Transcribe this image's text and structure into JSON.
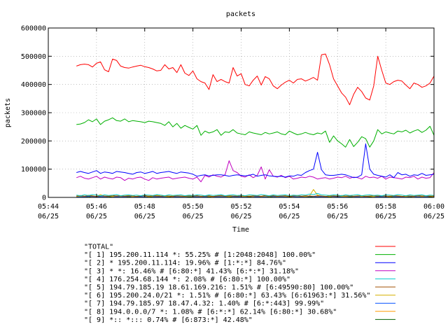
{
  "chart_data": {
    "type": "line",
    "title": "packets",
    "xlabel": "Time",
    "ylabel": "packets",
    "ylim": [
      0,
      600000
    ],
    "yticks": [
      0,
      100000,
      200000,
      300000,
      400000,
      500000,
      600000
    ],
    "ytick_labels": [
      "0",
      "100000",
      "200000",
      "300000",
      "400000",
      "500000",
      "600000"
    ],
    "xlim": [
      "05:44",
      "06:00"
    ],
    "xticks": [
      {
        "time": "05:44",
        "date": "06/25"
      },
      {
        "time": "05:46",
        "date": "06/25"
      },
      {
        "time": "05:48",
        "date": "06/25"
      },
      {
        "time": "05:50",
        "date": "06/25"
      },
      {
        "time": "05:52",
        "date": "06/25"
      },
      {
        "time": "05:54",
        "date": "06/25"
      },
      {
        "time": "05:56",
        "date": "06/25"
      },
      {
        "time": "05:58",
        "date": "06/25"
      },
      {
        "time": "06:00",
        "date": "06/25"
      }
    ],
    "grid": true,
    "legend_position": "bottom",
    "x": [
      "05:45:10",
      "05:45:20",
      "05:45:30",
      "05:45:40",
      "05:45:50",
      "05:46:00",
      "05:46:10",
      "05:46:20",
      "05:46:30",
      "05:46:40",
      "05:46:50",
      "05:47:00",
      "05:47:10",
      "05:47:20",
      "05:47:30",
      "05:47:40",
      "05:47:50",
      "05:48:00",
      "05:48:10",
      "05:48:20",
      "05:48:30",
      "05:48:40",
      "05:48:50",
      "05:49:00",
      "05:49:10",
      "05:49:20",
      "05:49:30",
      "05:49:40",
      "05:49:50",
      "05:50:00",
      "05:50:10",
      "05:50:20",
      "05:50:30",
      "05:50:40",
      "05:50:50",
      "05:51:00",
      "05:51:10",
      "05:51:20",
      "05:51:30",
      "05:51:40",
      "05:51:50",
      "05:52:00",
      "05:52:10",
      "05:52:20",
      "05:52:30",
      "05:52:40",
      "05:52:50",
      "05:53:00",
      "05:53:10",
      "05:53:20",
      "05:53:30",
      "05:53:40",
      "05:53:50",
      "05:54:00",
      "05:54:10",
      "05:54:20",
      "05:54:30",
      "05:54:40",
      "05:54:50",
      "05:55:00",
      "05:55:10",
      "05:55:20",
      "05:55:30",
      "05:55:40",
      "05:55:50",
      "05:56:00",
      "05:56:10",
      "05:56:20",
      "05:56:30",
      "05:56:40",
      "05:56:50",
      "05:57:00",
      "05:57:10",
      "05:57:20",
      "05:57:30",
      "05:57:40",
      "05:57:50",
      "05:58:00",
      "05:58:10",
      "05:58:20",
      "05:58:30",
      "05:58:40",
      "05:58:50",
      "05:59:00",
      "05:59:10",
      "05:59:20",
      "05:59:30",
      "05:59:40",
      "05:59:50",
      "06:00:00"
    ],
    "series": [
      {
        "name": "\"TOTAL\"",
        "color": "#ff0000",
        "values": [
          465000,
          470000,
          472000,
          470000,
          462000,
          475000,
          480000,
          452000,
          445000,
          490000,
          485000,
          465000,
          460000,
          458000,
          462000,
          465000,
          468000,
          463000,
          460000,
          455000,
          448000,
          450000,
          470000,
          455000,
          460000,
          442000,
          470000,
          440000,
          432000,
          448000,
          420000,
          410000,
          405000,
          382000,
          435000,
          410000,
          418000,
          410000,
          405000,
          460000,
          430000,
          438000,
          400000,
          395000,
          415000,
          430000,
          398000,
          428000,
          420000,
          395000,
          385000,
          398000,
          408000,
          415000,
          405000,
          418000,
          420000,
          412000,
          418000,
          425000,
          415000,
          505000,
          508000,
          470000,
          420000,
          395000,
          370000,
          355000,
          328000,
          365000,
          390000,
          375000,
          352000,
          345000,
          395000,
          500000,
          450000,
          405000,
          400000,
          410000,
          415000,
          412000,
          398000,
          385000,
          405000,
          400000,
          390000,
          395000,
          405000,
          430000
        ]
      },
      {
        "name": "\"[ 1] 195.200.11.114 *: 55.25% # [1:2048:2048] 100.00%\"",
        "color": "#00b000",
        "values": [
          258000,
          260000,
          265000,
          275000,
          268000,
          278000,
          258000,
          270000,
          275000,
          282000,
          272000,
          270000,
          278000,
          268000,
          272000,
          270000,
          268000,
          265000,
          270000,
          268000,
          265000,
          262000,
          255000,
          268000,
          250000,
          262000,
          245000,
          255000,
          248000,
          242000,
          255000,
          220000,
          235000,
          228000,
          232000,
          240000,
          220000,
          232000,
          230000,
          240000,
          228000,
          225000,
          222000,
          232000,
          228000,
          225000,
          222000,
          230000,
          225000,
          228000,
          232000,
          225000,
          222000,
          235000,
          228000,
          222000,
          225000,
          230000,
          225000,
          222000,
          228000,
          225000,
          235000,
          195000,
          218000,
          200000,
          190000,
          178000,
          205000,
          180000,
          195000,
          215000,
          208000,
          178000,
          200000,
          240000,
          225000,
          232000,
          228000,
          225000,
          235000,
          232000,
          238000,
          228000,
          235000,
          240000,
          230000,
          238000,
          252000,
          220000
        ]
      },
      {
        "name": "\"[ 2] * 195.200.11.114: 19.96% # [1:*:*] 84.76%\"",
        "color": "#0000ff",
        "values": [
          88000,
          92000,
          88000,
          85000,
          90000,
          95000,
          85000,
          90000,
          88000,
          85000,
          92000,
          90000,
          88000,
          85000,
          82000,
          88000,
          90000,
          85000,
          88000,
          92000,
          85000,
          88000,
          90000,
          92000,
          88000,
          85000,
          90000,
          88000,
          86000,
          82000,
          75000,
          78000,
          80000,
          76000,
          78000,
          80000,
          80000,
          78000,
          75000,
          78000,
          80000,
          78000,
          76000,
          78000,
          82000,
          75000,
          78000,
          80000,
          76000,
          75000,
          74000,
          75000,
          72000,
          76000,
          75000,
          80000,
          78000,
          88000,
          95000,
          100000,
          160000,
          98000,
          80000,
          78000,
          78000,
          80000,
          82000,
          80000,
          75000,
          70000,
          72000,
          80000,
          190000,
          100000,
          82000,
          78000,
          75000,
          72000,
          80000,
          70000,
          88000,
          80000,
          82000,
          75000,
          80000,
          78000,
          85000,
          78000,
          80000,
          82000
        ]
      },
      {
        "name": "\"[ 3] * *: 16.46% # [6:80:*] 41.43% [6:*:*] 31.18%\"",
        "color": "#c000c0",
        "values": [
          70000,
          75000,
          68000,
          65000,
          70000,
          75000,
          65000,
          72000,
          68000,
          65000,
          72000,
          70000,
          60000,
          68000,
          65000,
          70000,
          72000,
          65000,
          60000,
          70000,
          65000,
          68000,
          70000,
          72000,
          65000,
          68000,
          70000,
          72000,
          68000,
          65000,
          72000,
          55000,
          78000,
          72000,
          80000,
          75000,
          72000,
          80000,
          130000,
          95000,
          88000,
          75000,
          72000,
          80000,
          70000,
          78000,
          108000,
          65000,
          98000,
          75000,
          72000,
          78000,
          70000,
          75000,
          65000,
          68000,
          72000,
          70000,
          75000,
          72000,
          65000,
          68000,
          70000,
          65000,
          68000,
          72000,
          70000,
          75000,
          68000,
          72000,
          70000,
          65000,
          75000,
          70000,
          72000,
          68000,
          75000,
          65000,
          72000,
          70000,
          68000,
          65000,
          72000,
          70000,
          75000,
          65000,
          72000,
          68000,
          70000,
          88000
        ]
      },
      {
        "name": "\"[ 4] 176.254.68.144 *: 2.08% # [6:80:*] 100.00%\"",
        "color": "#00cccc",
        "values": [
          8000,
          6000,
          9000,
          7000,
          10000,
          8000,
          6000,
          9000,
          7000,
          8000,
          10000,
          6000,
          8000,
          9000,
          7000,
          8000,
          6000,
          9000,
          8000,
          7000,
          10000,
          8000,
          6000,
          9000,
          7000,
          8000,
          9000,
          6000,
          8000,
          7000,
          9000,
          8000,
          6000,
          9000,
          7000,
          8000,
          10000,
          6000,
          8000,
          9000,
          7000,
          8000,
          6000,
          9000,
          8000,
          7000,
          10000,
          8000,
          6000,
          9000,
          7000,
          8000,
          9000,
          6000,
          8000,
          7000,
          9000,
          8000,
          12000,
          10000,
          14000,
          9000,
          8000,
          7000,
          9000,
          8000,
          6000,
          9000,
          7000,
          8000,
          10000,
          6000,
          8000,
          9000,
          7000,
          8000,
          6000,
          9000,
          8000,
          7000,
          10000,
          8000,
          6000,
          9000,
          7000,
          8000,
          9000,
          6000,
          8000,
          7000
        ]
      },
      {
        "name": "\"[ 5] 194.79.185.19 18.61.169.216: 1.51% # [6:49590:80] 100.00%\"",
        "color": "#a05000",
        "values": [
          5000,
          7000,
          4000,
          6000,
          5000,
          3000,
          6000,
          5000,
          4000,
          7000,
          5000,
          6000,
          4000,
          5000,
          6000,
          3000,
          5000,
          7000,
          4000,
          6000,
          5000,
          4000,
          6000,
          5000,
          3000,
          6000,
          5000,
          4000,
          7000,
          5000,
          6000,
          4000,
          5000,
          6000,
          3000,
          5000,
          7000,
          4000,
          6000,
          5000,
          4000,
          6000,
          5000,
          3000,
          6000,
          5000,
          4000,
          7000,
          5000,
          6000,
          4000,
          5000,
          6000,
          3000,
          5000,
          7000,
          4000,
          6000,
          5000,
          4000,
          6000,
          5000,
          3000,
          6000,
          5000,
          4000,
          7000,
          5000,
          6000,
          4000,
          5000,
          6000,
          3000,
          5000,
          7000,
          4000,
          6000,
          5000,
          4000,
          6000,
          5000,
          3000,
          6000,
          5000,
          4000,
          7000,
          5000,
          6000,
          4000,
          5000
        ]
      },
      {
        "name": "\"[ 6] 195.200.24.0/21 *: 1.51% # [6:80:*] 63.43% [6:61963:*] 31.56%\"",
        "color": "#d4b000",
        "values": [
          3000,
          5000,
          4000,
          8000,
          6000,
          3000,
          10000,
          4000,
          5000,
          3000,
          6000,
          4000,
          5000,
          7000,
          3000,
          4000,
          6000,
          5000,
          3000,
          4000,
          8000,
          5000,
          4000,
          3000,
          6000,
          5000,
          4000,
          3000,
          5000,
          4000,
          6000,
          3000,
          5000,
          4000,
          3000,
          6000,
          5000,
          4000,
          3000,
          5000,
          6000,
          4000,
          3000,
          5000,
          4000,
          6000,
          3000,
          5000,
          4000,
          6000,
          3000,
          5000,
          4000,
          3000,
          6000,
          5000,
          4000,
          3000,
          5000,
          28000,
          8000,
          5000,
          4000,
          3000,
          6000,
          5000,
          4000,
          3000,
          5000,
          4000,
          6000,
          3000,
          5000,
          4000,
          3000,
          6000,
          5000,
          4000,
          3000,
          5000,
          6000,
          4000,
          3000,
          5000,
          4000,
          6000,
          3000,
          5000,
          4000,
          3000
        ]
      },
      {
        "name": "\"[ 7] 194.79.185.97 18.47.4.32: 1.40% # [6:*:443] 99.99%\"",
        "color": "#0050ff",
        "values": [
          2000,
          3000,
          2000,
          4000,
          3000,
          2000,
          3000,
          2000,
          4000,
          3000,
          2000,
          3000,
          2000,
          4000,
          3000,
          2000,
          3000,
          2000,
          4000,
          3000,
          2000,
          3000,
          2000,
          4000,
          3000,
          2000,
          3000,
          2000,
          4000,
          3000,
          2000,
          3000,
          2000,
          4000,
          3000,
          2000,
          3000,
          2000,
          4000,
          3000,
          2000,
          3000,
          2000,
          4000,
          3000,
          2000,
          3000,
          2000,
          4000,
          3000,
          2000,
          3000,
          2000,
          4000,
          3000,
          2000,
          3000,
          2000,
          4000,
          3000,
          2000,
          3000,
          2000,
          4000,
          3000,
          2000,
          3000,
          2000,
          4000,
          3000,
          2000,
          3000,
          2000,
          4000,
          3000,
          2000,
          3000,
          2000,
          4000,
          3000,
          2000,
          3000,
          2000,
          4000,
          3000,
          2000,
          3000,
          2000,
          4000,
          3000
        ]
      },
      {
        "name": "\"[ 8] 194.0.0.0/7 *: 1.08% # [6:*:*] 62.14% [6:80:*] 30.68%\"",
        "color": "#ff9900",
        "values": [
          4000,
          2000,
          3000,
          5000,
          2000,
          4000,
          3000,
          2000,
          5000,
          3000,
          4000,
          2000,
          3000,
          5000,
          2000,
          4000,
          3000,
          2000,
          5000,
          3000,
          4000,
          2000,
          3000,
          5000,
          2000,
          4000,
          3000,
          2000,
          5000,
          3000,
          4000,
          2000,
          3000,
          5000,
          2000,
          4000,
          3000,
          2000,
          5000,
          3000,
          4000,
          2000,
          3000,
          5000,
          2000,
          4000,
          3000,
          2000,
          5000,
          3000,
          4000,
          2000,
          3000,
          5000,
          2000,
          4000,
          3000,
          2000,
          5000,
          3000,
          4000,
          2000,
          3000,
          5000,
          2000,
          4000,
          3000,
          2000,
          5000,
          3000,
          4000,
          2000,
          3000,
          5000,
          2000,
          4000,
          3000,
          2000,
          5000,
          3000,
          4000,
          2000,
          3000,
          5000,
          2000,
          4000,
          3000,
          2000,
          5000,
          3000
        ]
      },
      {
        "name": "\"[ 9] *:: *::: 0.74% # [6:873:*] 42.48%\"",
        "color": "#006000",
        "values": [
          1000,
          2000,
          1000,
          3000,
          1000,
          2000,
          1000,
          2000,
          3000,
          1000,
          2000,
          1000,
          3000,
          1000,
          2000,
          1000,
          2000,
          3000,
          1000,
          2000,
          1000,
          3000,
          1000,
          2000,
          1000,
          2000,
          3000,
          1000,
          2000,
          1000,
          3000,
          1000,
          2000,
          1000,
          2000,
          3000,
          1000,
          2000,
          1000,
          3000,
          1000,
          2000,
          1000,
          2000,
          3000,
          1000,
          2000,
          1000,
          3000,
          1000,
          2000,
          1000,
          2000,
          3000,
          1000,
          2000,
          1000,
          3000,
          1000,
          2000,
          1000,
          2000,
          3000,
          1000,
          2000,
          1000,
          3000,
          1000,
          2000,
          1000,
          2000,
          3000,
          1000,
          2000,
          1000,
          3000,
          1000,
          2000,
          1000,
          2000,
          3000,
          1000,
          2000,
          1000,
          3000,
          1000,
          2000,
          1000,
          2000,
          3000
        ]
      }
    ]
  }
}
